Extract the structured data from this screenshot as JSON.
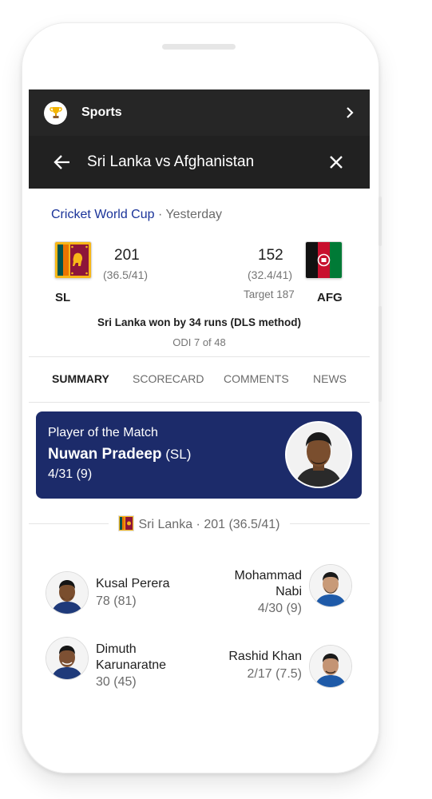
{
  "topbar": {
    "title": "Sports",
    "trophy_icon": "trophy-icon",
    "chevron_icon": "chevron-right-icon"
  },
  "header": {
    "title": "Sri Lanka vs Afghanistan",
    "back_icon": "arrow-left-icon",
    "close_icon": "close-icon"
  },
  "match": {
    "competition": "Cricket World Cup",
    "separator": " · ",
    "when": "Yesterday",
    "home": {
      "abbr": "SL",
      "score": "201",
      "overs": "(36.5/41)"
    },
    "away": {
      "abbr": "AFG",
      "score": "152",
      "overs": "(32.4/41)",
      "target": "Target 187"
    },
    "result": "Sri Lanka won by 34 runs (DLS method)",
    "series": "ODI 7 of 48"
  },
  "tabs": [
    "SUMMARY",
    "SCORECARD",
    "COMMENTS",
    "NEWS"
  ],
  "active_tab": "SUMMARY",
  "potm": {
    "label": "Player of the Match",
    "name": "Nuwan Pradeep",
    "team": " (SL)",
    "stat": "4/31 (9)"
  },
  "innings": {
    "text": "Sri Lanka · 201 (36.5/41)"
  },
  "performers": [
    {
      "left": {
        "name": "Kusal Perera",
        "stat": "78 (81)"
      },
      "right": {
        "name_line1": "Mohammad",
        "name_line2": "Nabi",
        "stat": "4/30 (9)"
      }
    },
    {
      "left": {
        "name_line1": "Dimuth",
        "name_line2": "Karunaratne",
        "stat": "30 (45)"
      },
      "right": {
        "name": "Rashid Khan",
        "stat": "2/17 (7.5)"
      }
    }
  ],
  "colors": {
    "accent_link": "#1a3399",
    "potm_bg": "#1c2b6a",
    "topbar_bg": "#262626",
    "header_bg": "#212121"
  }
}
